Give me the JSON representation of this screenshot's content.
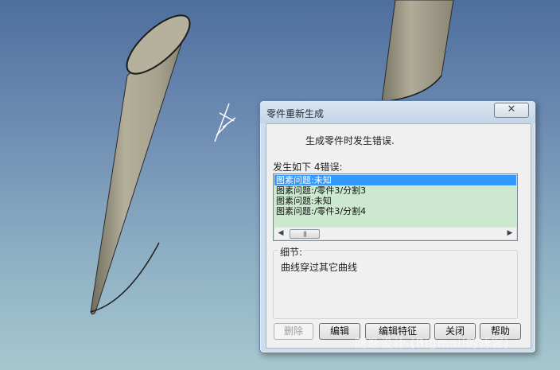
{
  "dialog": {
    "title": "零件重新生成",
    "close_icon": "close-icon",
    "message": "生成零件时发生错误.",
    "list_label": "发生如下 4错误:",
    "errors": [
      "图素问题:未知",
      "图素问题:/零件3/分割3",
      "图素问题:未知",
      "图素问题:/零件3/分割4"
    ],
    "selected_index": 0,
    "scroll_thumb_glyph": "|||",
    "details_label": "细节:",
    "details_text": "曲线穿过其它曲线",
    "buttons": {
      "delete": "删除",
      "edit": "编辑",
      "edit_feature": "编辑特征",
      "close": "关闭",
      "help": "帮助"
    }
  },
  "watermark": "随逸设计 (Bigmail的博客)",
  "colors": {
    "background_top": "#4e6e9e",
    "background_bottom": "#a6c7cf",
    "part_body": "#a8a491",
    "list_bg": "#cce8cf",
    "selection": "#3399ff"
  }
}
